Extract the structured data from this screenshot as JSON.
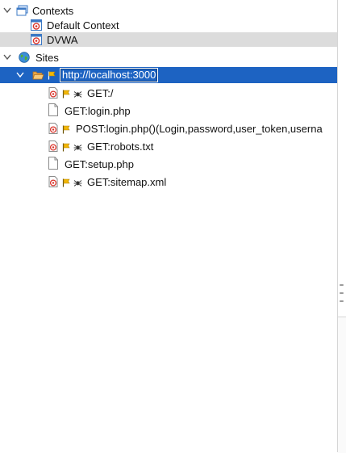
{
  "tree": {
    "contexts": {
      "label": "Contexts",
      "items": [
        {
          "label": "Default Context"
        },
        {
          "label": "DVWA"
        }
      ]
    },
    "sites": {
      "label": "Sites",
      "host": {
        "label": "http://localhost:3000",
        "children": [
          {
            "label": "GET:/",
            "icons": [
              "target",
              "flag",
              "spider"
            ]
          },
          {
            "label": "GET:login.php",
            "icons": [
              "page"
            ]
          },
          {
            "label": "POST:login.php()(Login,password,user_token,userna",
            "icons": [
              "target",
              "flag"
            ]
          },
          {
            "label": "GET:robots.txt",
            "icons": [
              "target",
              "flag",
              "spider"
            ]
          },
          {
            "label": "GET:setup.php",
            "icons": [
              "page"
            ]
          },
          {
            "label": "GET:sitemap.xml",
            "icons": [
              "target",
              "flag",
              "spider"
            ]
          }
        ]
      }
    }
  },
  "colors": {
    "selection": "#1d63c2",
    "context_selected": "#dcdcdc",
    "target_red": "#d9342b",
    "flag_yellow": "#f2b705"
  }
}
